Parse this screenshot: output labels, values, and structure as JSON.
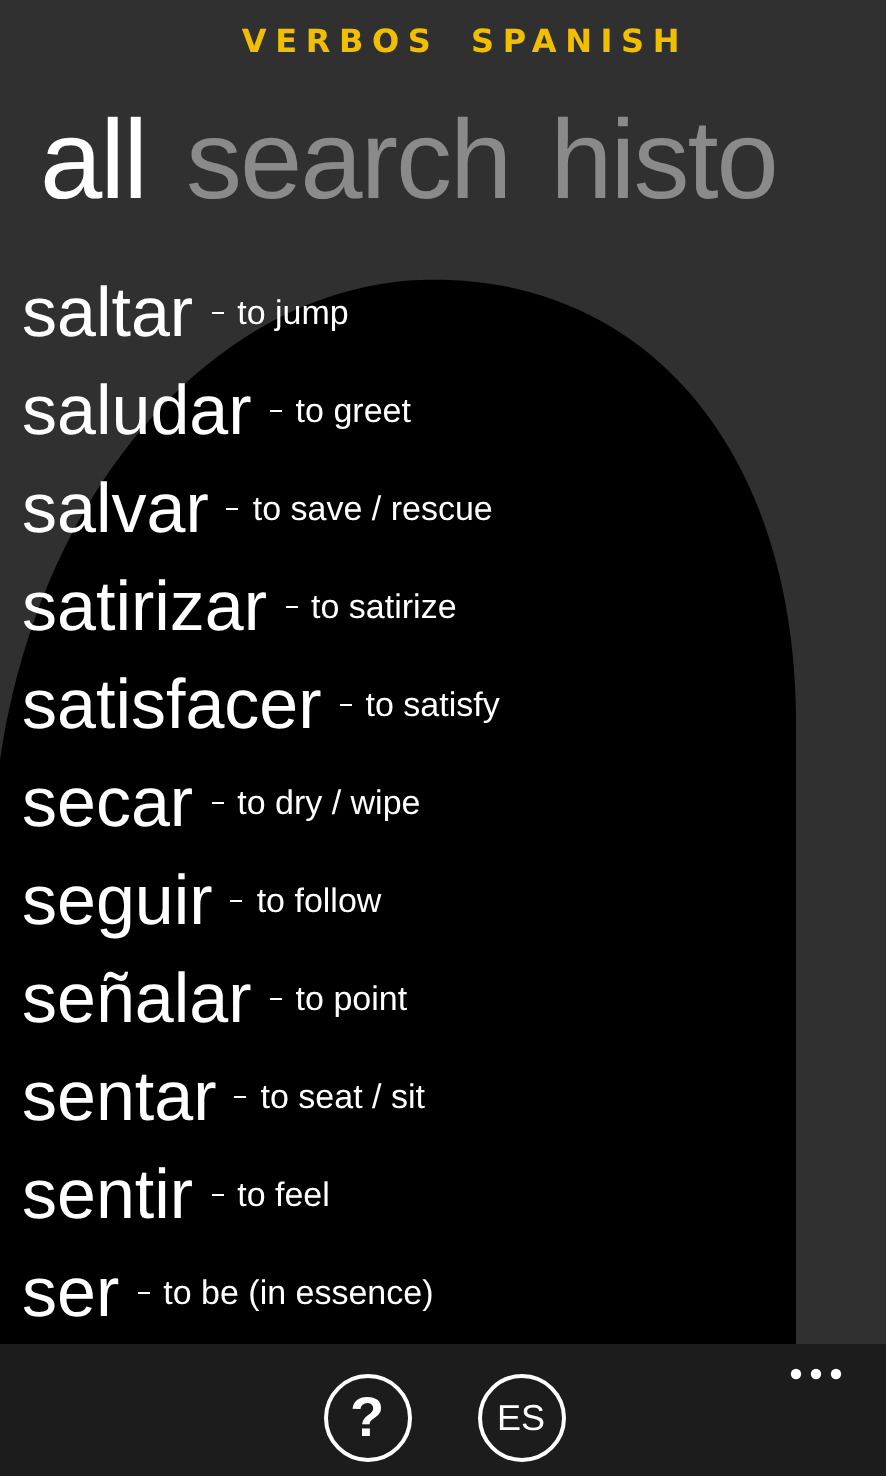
{
  "app_title": "VERBOS SPANISH",
  "pivots": [
    {
      "label": "all",
      "selected": true
    },
    {
      "label": "search",
      "selected": false
    },
    {
      "label": "histo",
      "selected": false
    }
  ],
  "verbs": [
    {
      "verb": "saltar",
      "meaning": "to jump"
    },
    {
      "verb": "saludar",
      "meaning": "to greet"
    },
    {
      "verb": "salvar",
      "meaning": "to save / rescue"
    },
    {
      "verb": "satirizar",
      "meaning": "to satirize"
    },
    {
      "verb": "satisfacer",
      "meaning": "to satisfy"
    },
    {
      "verb": "secar",
      "meaning": "to dry / wipe"
    },
    {
      "verb": "seguir",
      "meaning": "to follow"
    },
    {
      "verb": "señalar",
      "meaning": "to point"
    },
    {
      "verb": "sentar",
      "meaning": "to seat / sit"
    },
    {
      "verb": "sentir",
      "meaning": "to feel"
    },
    {
      "verb": "ser",
      "meaning": "to be (in essence)"
    }
  ],
  "app_bar": {
    "buttons": [
      {
        "label": "?",
        "kind": "help"
      },
      {
        "label": "ES",
        "kind": "language"
      }
    ]
  }
}
